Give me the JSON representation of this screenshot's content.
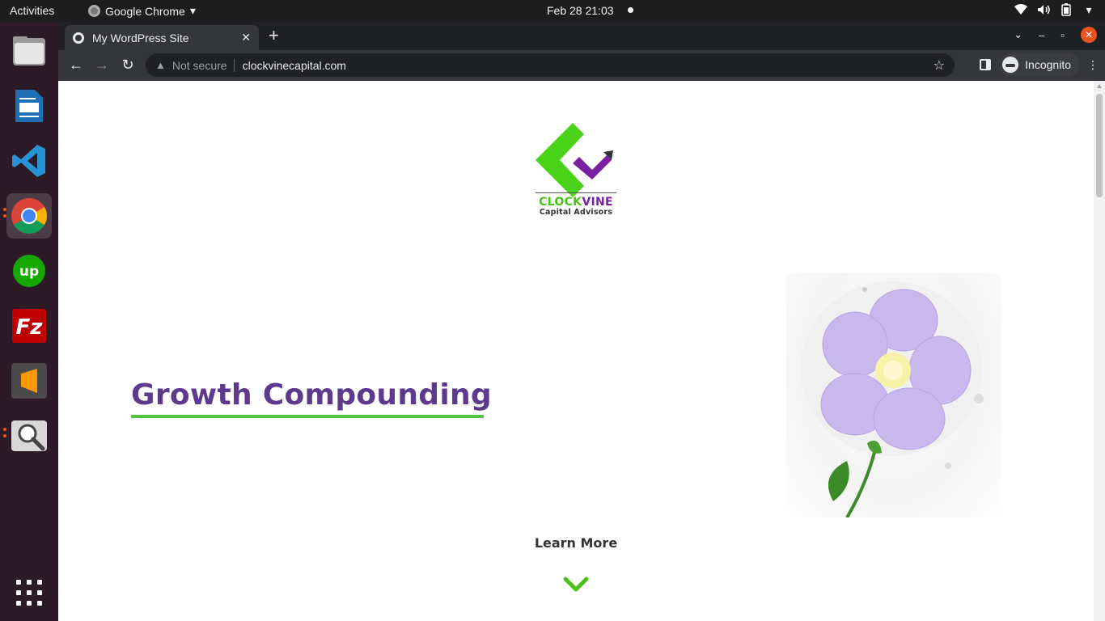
{
  "topbar": {
    "activities": "Activities",
    "app_name": "Google Chrome",
    "clock": "Feb 28  21:03"
  },
  "dock": {
    "apps": [
      "files-icon",
      "libreoffice-writer-icon",
      "vscode-icon",
      "chrome-icon",
      "upwork-icon",
      "filezilla-icon",
      "sublime-text-icon",
      "image-viewer-icon"
    ]
  },
  "browser": {
    "tab_title": "My WordPress Site",
    "security_label": "Not secure",
    "url": "clockvinecapital.com",
    "profile_label": "Incognito"
  },
  "page": {
    "logo_brand_green": "CLOCK",
    "logo_brand_purple": "VINE",
    "logo_tagline": "Capital Advisors",
    "headline": "Growth Compounding",
    "cta": "Learn More"
  },
  "colors": {
    "brand_green": "#4bc21b",
    "brand_purple": "#7b1fa2",
    "headline": "#5d3a8e",
    "underline": "#55c243"
  }
}
